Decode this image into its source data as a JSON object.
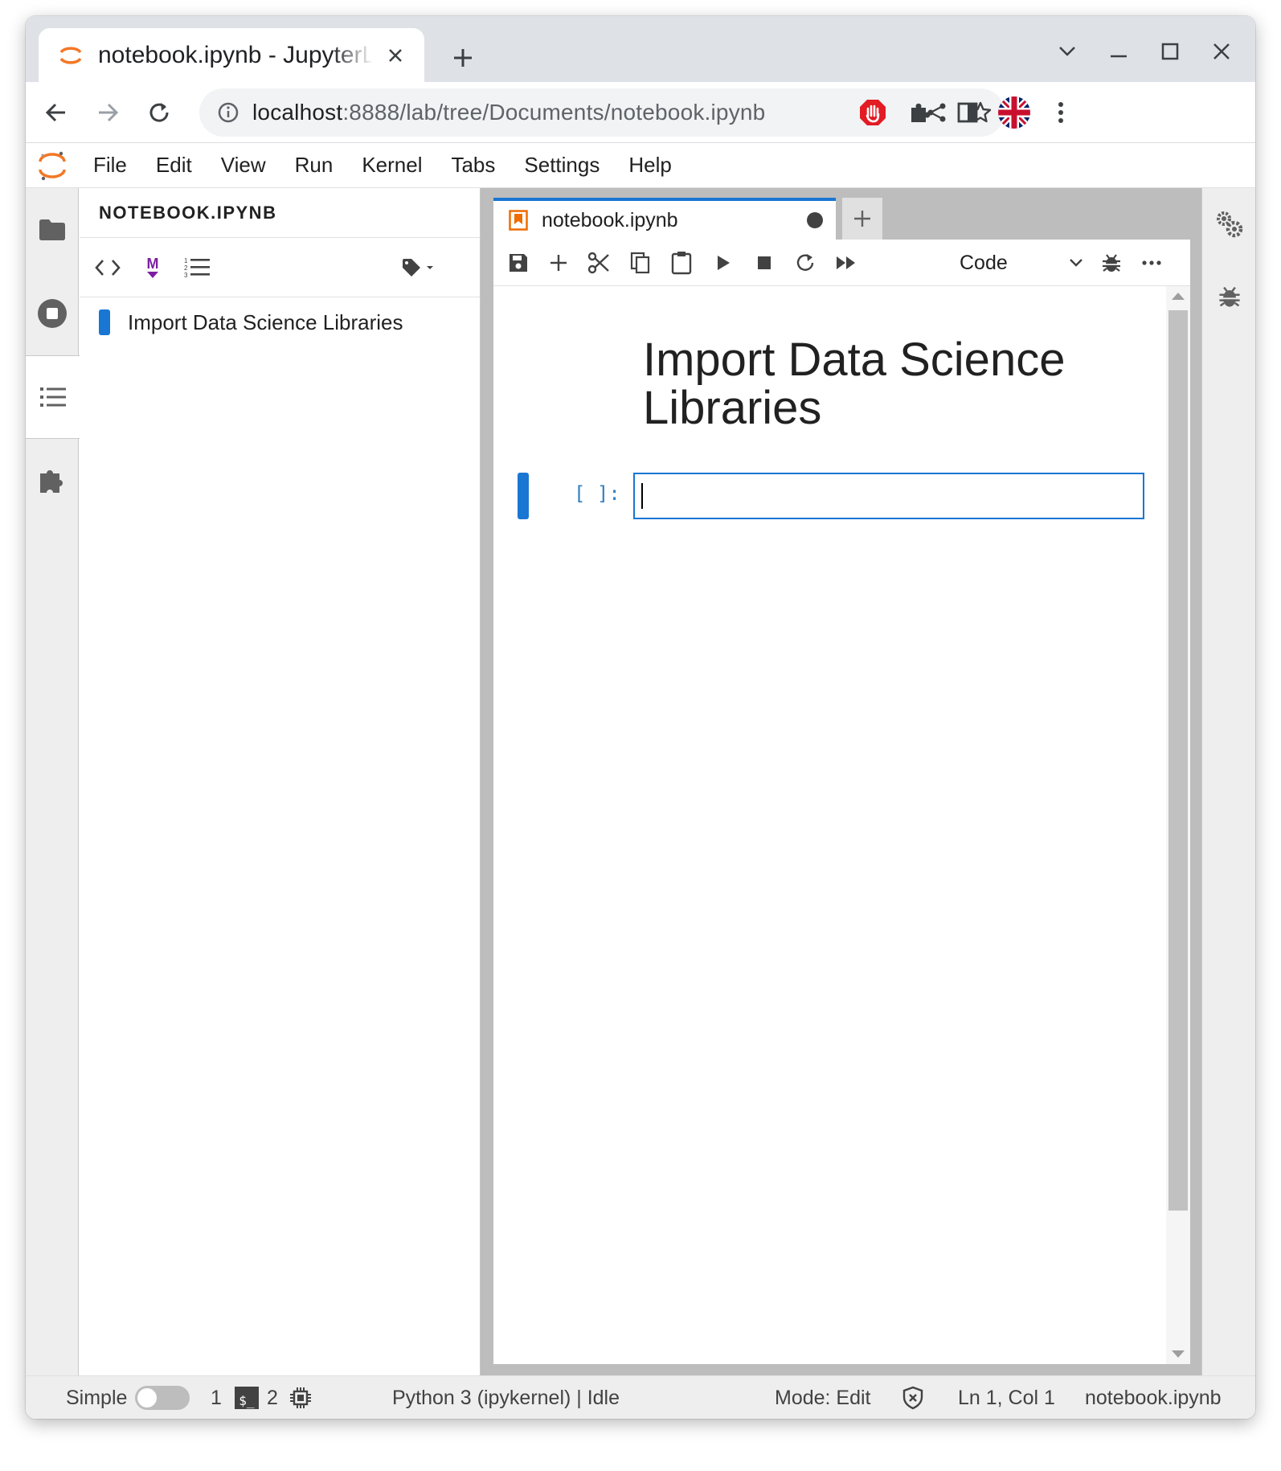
{
  "browser": {
    "tab_title": "notebook.ipynb - JupyterLab",
    "url_host": "localhost",
    "url_path": ":8888/lab/tree/Documents/notebook.ipynb"
  },
  "menubar": {
    "items": [
      "File",
      "Edit",
      "View",
      "Run",
      "Kernel",
      "Tabs",
      "Settings",
      "Help"
    ]
  },
  "toc": {
    "header": "NOTEBOOK.IPYNB",
    "items": [
      "Import Data Science Libraries"
    ]
  },
  "notebook": {
    "tab_label": "notebook.ipynb",
    "cell_type": "Code",
    "heading": "Import Data Science Libraries",
    "prompt": "[ ]:",
    "code": ""
  },
  "statusbar": {
    "mode_label": "Simple",
    "terminals_count": "1",
    "terminal_badge": "$_",
    "kernels_count": "2",
    "kernel_status": "Python 3 (ipykernel) | Idle",
    "mode": "Mode: Edit",
    "cursor": "Ln 1, Col 1",
    "file": "notebook.ipynb"
  },
  "colors": {
    "accent": "#1976d2",
    "jupyter_orange": "#f37726",
    "prompt_blue": "#307fc1"
  }
}
